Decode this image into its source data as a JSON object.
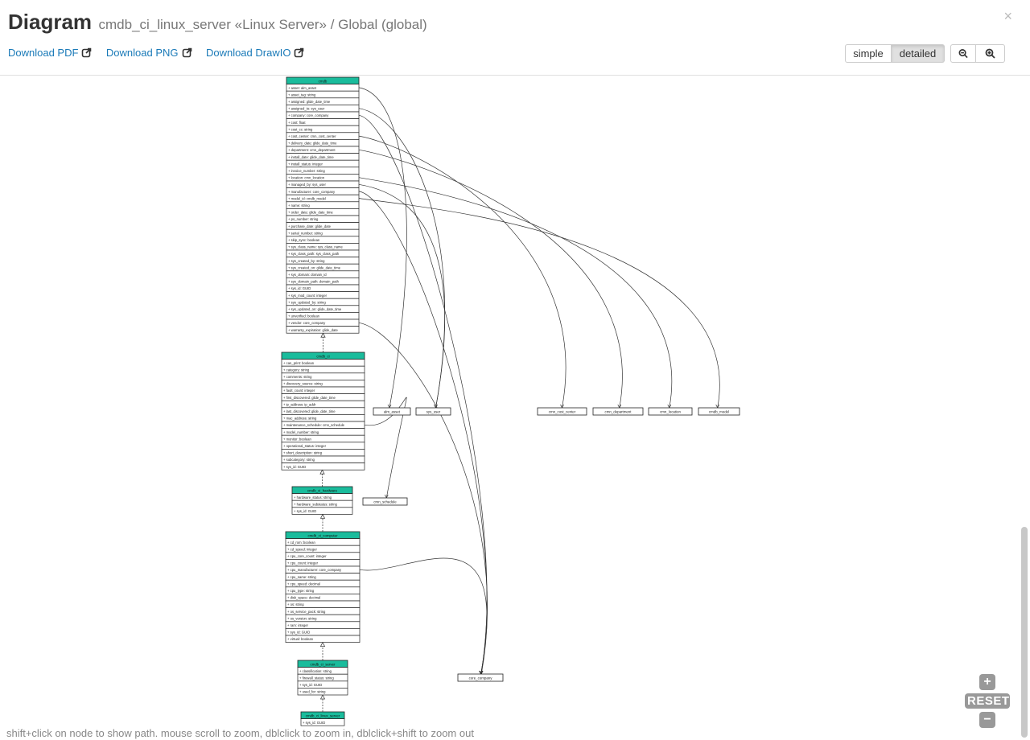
{
  "header": {
    "title": "Diagram",
    "subtitle": "cmdb_ci_linux_server  «Linux Server» / Global (global)",
    "close": "×"
  },
  "downloads": [
    {
      "label": "Download PDF",
      "name": "download-pdf-link"
    },
    {
      "label": "Download PNG",
      "name": "download-png-link"
    },
    {
      "label": "Download DrawIO",
      "name": "download-drawio-link"
    }
  ],
  "view_toggle": {
    "simple": "simple",
    "detailed": "detailed",
    "active": "detailed"
  },
  "zoom_controls": {
    "reset": "RESET"
  },
  "hint": "shift+click on node to show path. mouse scroll to zoom, dblclick to zoom in, dblclick+shift to zoom out",
  "colors": {
    "header_fill": "#1abc9c",
    "link": "#1a7ab8"
  },
  "diagram": {
    "classes": [
      {
        "name": "cmdb",
        "fields": [
          "+ asset: alm_asset",
          "+ asset_tag: string",
          "+ assigned: glide_date_time",
          "+ assigned_to: sys_user",
          "+ company: core_company",
          "+ cost: float",
          "+ cost_cc: string",
          "+ cost_center: cmn_cost_center",
          "+ delivery_date: glide_date_time",
          "+ department: cmn_department",
          "+ install_date: glide_date_time",
          "+ install_status: integer",
          "+ invoice_number: string",
          "+ location: cmn_location",
          "+ managed_by: sys_user",
          "+ manufacturer: core_company",
          "+ model_id: cmdb_model",
          "+ name: string",
          "+ order_date: glide_date_time",
          "+ po_number: string",
          "+ purchase_date: glide_date",
          "+ serial_number: string",
          "+ skip_sync: boolean",
          "+ sys_class_name: sys_class_name",
          "+ sys_class_path: sys_class_path",
          "+ sys_created_by: string",
          "+ sys_created_on: glide_date_time",
          "+ sys_domain: domain_id",
          "+ sys_domain_path: domain_path",
          "+ sys_id: GUID",
          "+ sys_mod_count: integer",
          "+ sys_updated_by: string",
          "+ sys_updated_on: glide_date_time",
          "+ unverified: boolean",
          "+ vendor: core_company",
          "+ warranty_expiration: glide_date"
        ]
      },
      {
        "name": "cmdb_ci",
        "fields": [
          "+ can_print: boolean",
          "+ category: string",
          "+ comments: string",
          "+ discovery_source: string",
          "+ fault_count: integer",
          "+ first_discovered: glide_date_time",
          "+ ip_address: ip_addr",
          "+ last_discovered: glide_date_time",
          "+ mac_address: string",
          "+ maintenance_schedule: cmn_schedule",
          "+ model_number: string",
          "+ monitor: boolean",
          "+ operational_status: integer",
          "+ short_description: string",
          "+ subcategory: string",
          "+ sys_id: GUID"
        ]
      },
      {
        "name": "cmdb_ci_hardware",
        "fields": [
          "+ hardware_status: string",
          "+ hardware_substatus: string",
          "+ sys_id: GUID"
        ]
      },
      {
        "name": "cmdb_ci_computer",
        "fields": [
          "+ cd_rom: boolean",
          "+ cd_speed: integer",
          "+ cpu_core_count: integer",
          "+ cpu_count: integer",
          "+ cpu_manufacturer: core_company",
          "+ cpu_name: string",
          "+ cpu_speed: decimal",
          "+ cpu_type: string",
          "+ disk_space: decimal",
          "+ os: string",
          "+ os_service_pack: string",
          "+ os_version: string",
          "+ ram: integer",
          "+ sys_id: GUID",
          "+ virtual: boolean"
        ]
      },
      {
        "name": "cmdb_ci_server",
        "fields": [
          "+ classification: string",
          "+ firewall_status: string",
          "+ sys_id: GUID",
          "+ used_for: string"
        ]
      },
      {
        "name": "cmdb_ci_linux_server",
        "fields": [
          "+ sys_id: GUID"
        ]
      }
    ],
    "refs": [
      "alm_asset",
      "sys_user",
      "cmn_cost_center",
      "cmn_department",
      "cmn_location",
      "cmdb_model",
      "cmn_schedule",
      "core_company"
    ]
  }
}
